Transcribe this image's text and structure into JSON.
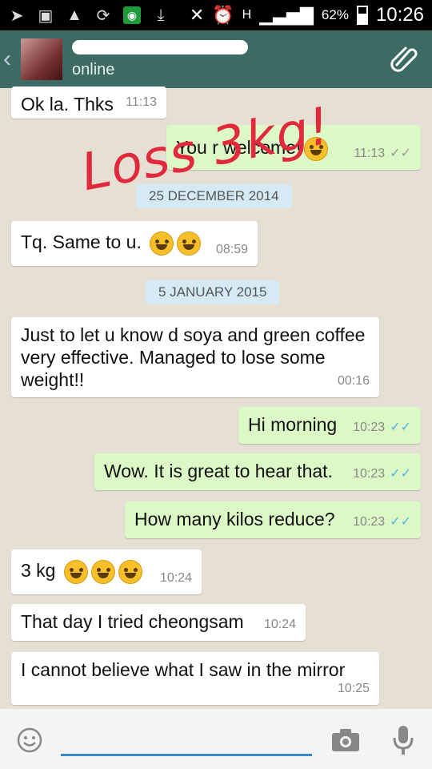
{
  "status_bar": {
    "network": "H",
    "battery_percent": "62%",
    "time": "10:26"
  },
  "header": {
    "contact_status": "online"
  },
  "annotation": {
    "overlay_text": "Loss 3kg!"
  },
  "messages": [
    {
      "dir": "in",
      "text": "Ok la. Thks",
      "time": "11:13"
    },
    {
      "dir": "out",
      "text": "You r welcome!",
      "time": "11:13",
      "ticks": "✓✓"
    },
    {
      "dir": "in",
      "text": "Tq. Same to u.",
      "time": "08:59"
    },
    {
      "dir": "in",
      "text": "Just to let u know d soya and green coffee very effective. Managed to lose some weight!!",
      "time": "00:16"
    },
    {
      "dir": "out",
      "text": "Hi morning",
      "time": "10:23",
      "ticks": "✓✓"
    },
    {
      "dir": "out",
      "text": "Wow. It is great to hear that.",
      "time": "10:23",
      "ticks": "✓✓"
    },
    {
      "dir": "out",
      "text": "How many kilos reduce?",
      "time": "10:23",
      "ticks": "✓✓"
    },
    {
      "dir": "in",
      "text": "3 kg",
      "time": "10:24"
    },
    {
      "dir": "in",
      "text": "That day I tried cheongsam",
      "time": "10:24"
    },
    {
      "dir": "in",
      "text": "I cannot believe what I saw in the mirror",
      "time": "10:25"
    }
  ],
  "date_chips": [
    "25 DECEMBER 2014",
    "5 JANUARY 2015"
  ],
  "colors": {
    "header": "#3d6b63",
    "outgoing_bubble": "#dcf8c6",
    "read_ticks": "#4fb5e4",
    "annotation": "#e0293b"
  },
  "icons": [
    "back-chevron",
    "paperclip",
    "emoji-face",
    "camera",
    "microphone"
  ]
}
